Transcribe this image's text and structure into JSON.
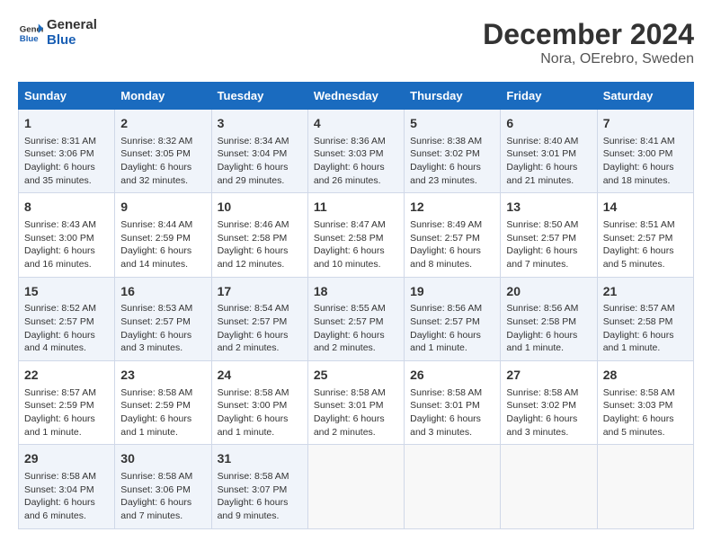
{
  "logo": {
    "line1": "General",
    "line2": "Blue"
  },
  "title": "December 2024",
  "subtitle": "Nora, OErebro, Sweden",
  "headers": [
    "Sunday",
    "Monday",
    "Tuesday",
    "Wednesday",
    "Thursday",
    "Friday",
    "Saturday"
  ],
  "weeks": [
    [
      {
        "day": "1",
        "lines": [
          "Sunrise: 8:31 AM",
          "Sunset: 3:06 PM",
          "Daylight: 6 hours",
          "and 35 minutes."
        ]
      },
      {
        "day": "2",
        "lines": [
          "Sunrise: 8:32 AM",
          "Sunset: 3:05 PM",
          "Daylight: 6 hours",
          "and 32 minutes."
        ]
      },
      {
        "day": "3",
        "lines": [
          "Sunrise: 8:34 AM",
          "Sunset: 3:04 PM",
          "Daylight: 6 hours",
          "and 29 minutes."
        ]
      },
      {
        "day": "4",
        "lines": [
          "Sunrise: 8:36 AM",
          "Sunset: 3:03 PM",
          "Daylight: 6 hours",
          "and 26 minutes."
        ]
      },
      {
        "day": "5",
        "lines": [
          "Sunrise: 8:38 AM",
          "Sunset: 3:02 PM",
          "Daylight: 6 hours",
          "and 23 minutes."
        ]
      },
      {
        "day": "6",
        "lines": [
          "Sunrise: 8:40 AM",
          "Sunset: 3:01 PM",
          "Daylight: 6 hours",
          "and 21 minutes."
        ]
      },
      {
        "day": "7",
        "lines": [
          "Sunrise: 8:41 AM",
          "Sunset: 3:00 PM",
          "Daylight: 6 hours",
          "and 18 minutes."
        ]
      }
    ],
    [
      {
        "day": "8",
        "lines": [
          "Sunrise: 8:43 AM",
          "Sunset: 3:00 PM",
          "Daylight: 6 hours",
          "and 16 minutes."
        ]
      },
      {
        "day": "9",
        "lines": [
          "Sunrise: 8:44 AM",
          "Sunset: 2:59 PM",
          "Daylight: 6 hours",
          "and 14 minutes."
        ]
      },
      {
        "day": "10",
        "lines": [
          "Sunrise: 8:46 AM",
          "Sunset: 2:58 PM",
          "Daylight: 6 hours",
          "and 12 minutes."
        ]
      },
      {
        "day": "11",
        "lines": [
          "Sunrise: 8:47 AM",
          "Sunset: 2:58 PM",
          "Daylight: 6 hours",
          "and 10 minutes."
        ]
      },
      {
        "day": "12",
        "lines": [
          "Sunrise: 8:49 AM",
          "Sunset: 2:57 PM",
          "Daylight: 6 hours",
          "and 8 minutes."
        ]
      },
      {
        "day": "13",
        "lines": [
          "Sunrise: 8:50 AM",
          "Sunset: 2:57 PM",
          "Daylight: 6 hours",
          "and 7 minutes."
        ]
      },
      {
        "day": "14",
        "lines": [
          "Sunrise: 8:51 AM",
          "Sunset: 2:57 PM",
          "Daylight: 6 hours",
          "and 5 minutes."
        ]
      }
    ],
    [
      {
        "day": "15",
        "lines": [
          "Sunrise: 8:52 AM",
          "Sunset: 2:57 PM",
          "Daylight: 6 hours",
          "and 4 minutes."
        ]
      },
      {
        "day": "16",
        "lines": [
          "Sunrise: 8:53 AM",
          "Sunset: 2:57 PM",
          "Daylight: 6 hours",
          "and 3 minutes."
        ]
      },
      {
        "day": "17",
        "lines": [
          "Sunrise: 8:54 AM",
          "Sunset: 2:57 PM",
          "Daylight: 6 hours",
          "and 2 minutes."
        ]
      },
      {
        "day": "18",
        "lines": [
          "Sunrise: 8:55 AM",
          "Sunset: 2:57 PM",
          "Daylight: 6 hours",
          "and 2 minutes."
        ]
      },
      {
        "day": "19",
        "lines": [
          "Sunrise: 8:56 AM",
          "Sunset: 2:57 PM",
          "Daylight: 6 hours",
          "and 1 minute."
        ]
      },
      {
        "day": "20",
        "lines": [
          "Sunrise: 8:56 AM",
          "Sunset: 2:58 PM",
          "Daylight: 6 hours",
          "and 1 minute."
        ]
      },
      {
        "day": "21",
        "lines": [
          "Sunrise: 8:57 AM",
          "Sunset: 2:58 PM",
          "Daylight: 6 hours",
          "and 1 minute."
        ]
      }
    ],
    [
      {
        "day": "22",
        "lines": [
          "Sunrise: 8:57 AM",
          "Sunset: 2:59 PM",
          "Daylight: 6 hours",
          "and 1 minute."
        ]
      },
      {
        "day": "23",
        "lines": [
          "Sunrise: 8:58 AM",
          "Sunset: 2:59 PM",
          "Daylight: 6 hours",
          "and 1 minute."
        ]
      },
      {
        "day": "24",
        "lines": [
          "Sunrise: 8:58 AM",
          "Sunset: 3:00 PM",
          "Daylight: 6 hours",
          "and 1 minute."
        ]
      },
      {
        "day": "25",
        "lines": [
          "Sunrise: 8:58 AM",
          "Sunset: 3:01 PM",
          "Daylight: 6 hours",
          "and 2 minutes."
        ]
      },
      {
        "day": "26",
        "lines": [
          "Sunrise: 8:58 AM",
          "Sunset: 3:01 PM",
          "Daylight: 6 hours",
          "and 3 minutes."
        ]
      },
      {
        "day": "27",
        "lines": [
          "Sunrise: 8:58 AM",
          "Sunset: 3:02 PM",
          "Daylight: 6 hours",
          "and 3 minutes."
        ]
      },
      {
        "day": "28",
        "lines": [
          "Sunrise: 8:58 AM",
          "Sunset: 3:03 PM",
          "Daylight: 6 hours",
          "and 5 minutes."
        ]
      }
    ],
    [
      {
        "day": "29",
        "lines": [
          "Sunrise: 8:58 AM",
          "Sunset: 3:04 PM",
          "Daylight: 6 hours",
          "and 6 minutes."
        ]
      },
      {
        "day": "30",
        "lines": [
          "Sunrise: 8:58 AM",
          "Sunset: 3:06 PM",
          "Daylight: 6 hours",
          "and 7 minutes."
        ]
      },
      {
        "day": "31",
        "lines": [
          "Sunrise: 8:58 AM",
          "Sunset: 3:07 PM",
          "Daylight: 6 hours",
          "and 9 minutes."
        ]
      },
      null,
      null,
      null,
      null
    ]
  ]
}
